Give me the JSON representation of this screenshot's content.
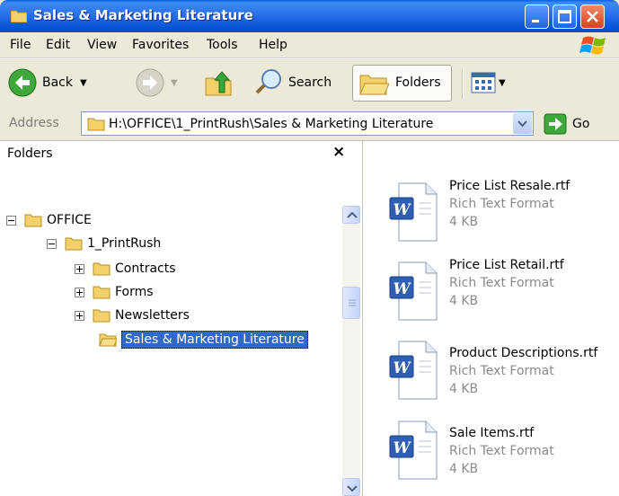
{
  "window": {
    "title": "Sales & Marketing Literature"
  },
  "menu": {
    "items": [
      "File",
      "Edit",
      "View",
      "Favorites",
      "Tools",
      "Help"
    ]
  },
  "toolbar": {
    "back_label": "Back",
    "search_label": "Search",
    "folders_label": "Folders"
  },
  "address": {
    "label": "Address",
    "path": "H:\\OFFICE\\1_PrintRush\\Sales & Marketing Literature",
    "go_label": "Go"
  },
  "folders_pane": {
    "title": "Folders",
    "close_glyph": "×",
    "tree": [
      {
        "label": "OFFICE",
        "expander": "minus",
        "level": 0
      },
      {
        "label": "1_PrintRush",
        "expander": "minus",
        "level": 1
      },
      {
        "label": "Contracts",
        "expander": "plus",
        "level": 2
      },
      {
        "label": "Forms",
        "expander": "plus",
        "level": 2
      },
      {
        "label": "Newsletters",
        "expander": "plus",
        "level": 2
      },
      {
        "label": "Sales & Marketing Literature",
        "expander": "none",
        "level": 2,
        "selected": true
      }
    ]
  },
  "files": [
    {
      "name": "Price List Resale.rtf",
      "type": "Rich Text Format",
      "size": "4 KB"
    },
    {
      "name": "Price List Retail.rtf",
      "type": "Rich Text Format",
      "size": "4 KB"
    },
    {
      "name": "Product Descriptions.rtf",
      "type": "Rich Text Format",
      "size": "4 KB"
    },
    {
      "name": "Sale Items.rtf",
      "type": "Rich Text Format",
      "size": "4 KB"
    }
  ],
  "colors": {
    "titlebar": "#0a5fe0",
    "selection": "#316ac5",
    "face": "#ece9d8"
  }
}
